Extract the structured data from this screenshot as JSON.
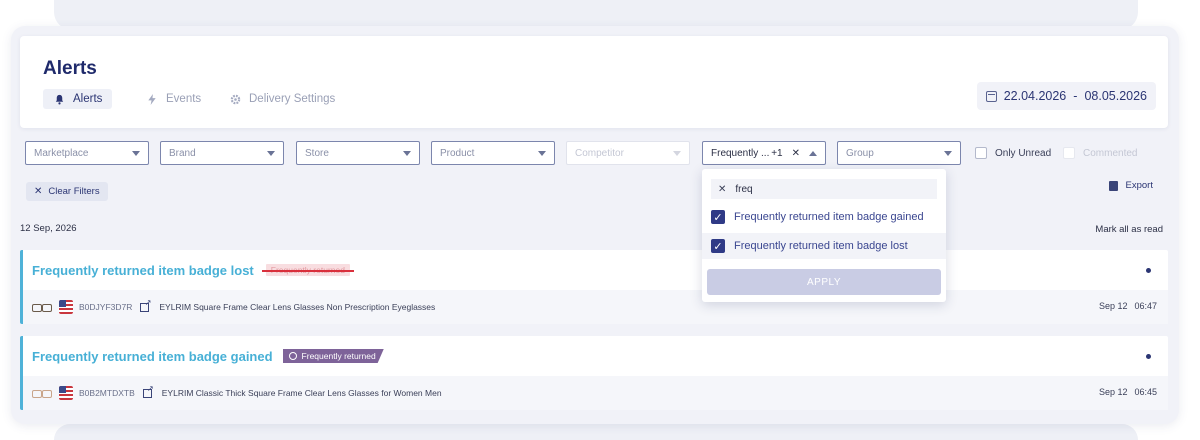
{
  "header": {
    "title": "Alerts",
    "tabs": [
      {
        "label": "Alerts",
        "icon": "bell-icon",
        "active": true
      },
      {
        "label": "Events",
        "icon": "bolt-icon",
        "active": false
      },
      {
        "label": "Delivery Settings",
        "icon": "gear-icon",
        "active": false
      }
    ],
    "date_from": "22.04.2026",
    "date_sep": "-",
    "date_to": "08.05.2026"
  },
  "filters": {
    "marketplace": "Marketplace",
    "brand": "Brand",
    "store": "Store",
    "product": "Product",
    "competitor": "Competitor",
    "type_value": "Frequently ...",
    "type_extra": "+1",
    "group": "Group",
    "only_unread": "Only Unread",
    "commented": "Commented"
  },
  "toolbar": {
    "clear_filters": "Clear Filters",
    "export": "Export",
    "mark_all_read": "Mark all as read"
  },
  "dropdown": {
    "search_value": "freq",
    "options": [
      {
        "label": "Frequently returned item badge gained",
        "checked": true
      },
      {
        "label": "Frequently returned item badge lost",
        "checked": true
      }
    ],
    "apply_label": "APPLY"
  },
  "group_date": "12 Sep, 2026",
  "alerts": [
    {
      "title": "Frequently returned item badge lost",
      "badge": "Frequently returned",
      "asin": "B0DJYF3D7R",
      "product": "EYLRIM Square Frame Clear Lens Glasses Non Prescription Eyeglasses",
      "date": "Sep 12",
      "time": "06:47"
    },
    {
      "title": "Frequently returned item badge gained",
      "badge": "Frequently  returned",
      "asin": "B0B2MTDXTB",
      "product": "EYLRIM Classic Thick Square Frame Clear Lens Glasses for Women Men",
      "date": "Sep 12",
      "time": "06:45"
    }
  ],
  "colors": {
    "accent": "#47b0d6",
    "primary": "#2f3a86",
    "badge_gained": "#7e6399",
    "badge_lost_strike": "#d9303c"
  }
}
